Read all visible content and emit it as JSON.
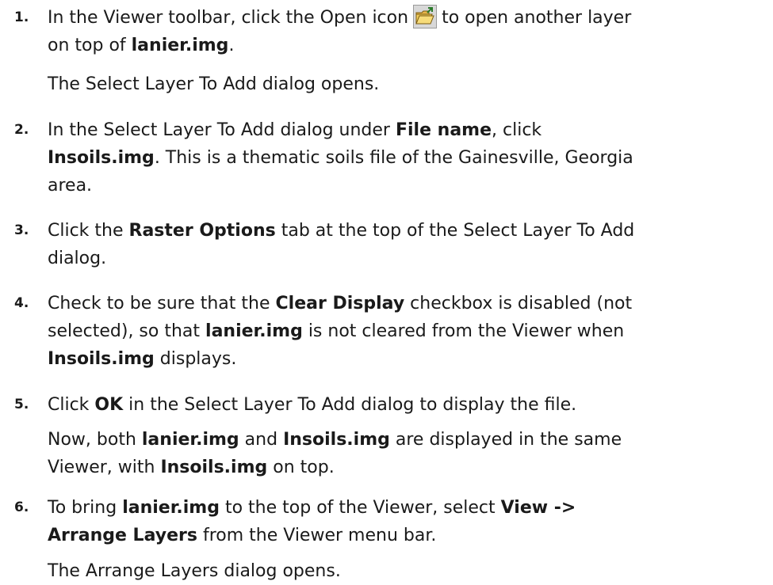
{
  "steps": [
    {
      "number": "1.",
      "lines": [
        {
          "before": "In the Viewer toolbar, click the Open icon",
          "after": "to open another layer"
        },
        {
          "pre": "on top of ",
          "bold": "lanier.img",
          "post": "."
        }
      ],
      "note": "The Select Layer To Add dialog opens.",
      "icon": "open-folder-icon"
    },
    {
      "number": "2.",
      "lines": [
        {
          "pre": "In the Select Layer To Add dialog under ",
          "bold": "File name",
          "post": ", click"
        },
        {
          "bold": "Insoils.img",
          "post": ". This is a thematic soils file of the Gainesville, Georgia"
        },
        {
          "post": "area."
        }
      ]
    },
    {
      "number": "3.",
      "lines": [
        {
          "pre": "Click the ",
          "bold": "Raster Options",
          "post": " tab at the top of the Select Layer To Add"
        },
        {
          "post": "dialog."
        }
      ]
    },
    {
      "number": "4.",
      "lines": [
        {
          "pre": "Check to be sure that the ",
          "bold": "Clear Display",
          "post": " checkbox is disabled (not"
        },
        {
          "pre": "selected), so that ",
          "bold": "lanier.img",
          "post": " is not cleared from the Viewer when"
        },
        {
          "bold": "Insoils.img",
          "post": " displays."
        }
      ]
    },
    {
      "number": "5.",
      "lines": [
        {
          "pre": "Click ",
          "bold": "OK",
          "post": " in the Select Layer To Add dialog to display the file."
        }
      ],
      "note_parts": [
        {
          "pre": "Now, both ",
          "bold": "lanier.img",
          "mid": " and ",
          "bold2": "Insoils.img",
          "post": " are displayed in the same"
        },
        {
          "pre": "Viewer, with ",
          "bold": "Insoils.img",
          "post": " on top."
        }
      ]
    },
    {
      "number": "6.",
      "lines": [
        {
          "pre": "To bring ",
          "bold": "lanier.img",
          "post": " to the top of the Viewer, select ",
          "bold2": "View ->"
        },
        {
          "bold": "Arrange Layers",
          "post": " from the Viewer menu bar."
        }
      ],
      "note": "The Arrange Layers dialog opens."
    }
  ]
}
